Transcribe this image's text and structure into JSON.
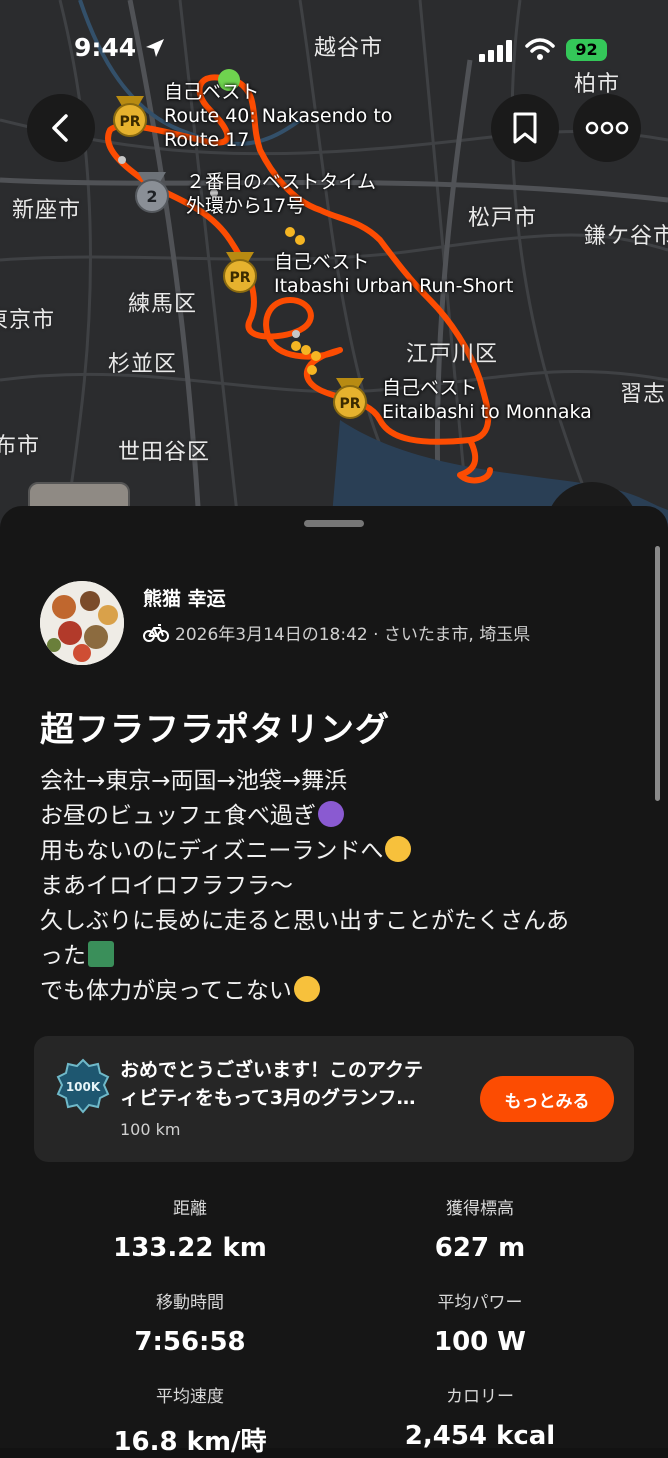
{
  "status_bar": {
    "time": "9:44",
    "battery": "92"
  },
  "map": {
    "places": [
      "越谷市",
      "柏市",
      "新座市",
      "松戸市",
      "鎌ケ谷市",
      "練馬区",
      "東京市",
      "杉並区",
      "江戸川区",
      "習志",
      "布市",
      "世田谷区"
    ],
    "segments": [
      {
        "badge": "PR",
        "lines": [
          "自己ベスト",
          "Route 40: Nakasendo to",
          "Route 17"
        ]
      },
      {
        "badge": "2",
        "lines": [
          "２番目のベストタイム",
          "外環から17号"
        ]
      },
      {
        "badge": "PR",
        "lines": [
          "自己ベスト",
          "Itabashi Urban Run-Short"
        ]
      },
      {
        "badge": "PR",
        "lines": [
          "自己ベスト",
          "Eitaibashi to Monnaka"
        ]
      }
    ],
    "colors": {
      "route": "#fc4c02",
      "pr_gold": "#e6b22e",
      "silver": "#8a8f96"
    }
  },
  "activity": {
    "athlete": "熊猫 幸运",
    "meta": "2026年3月14日の18:42 · さいたま市, 埼玉県",
    "title": "超フラフラポタリング",
    "description": [
      "会社→東京→両国→池袋→舞浜",
      "お昼のビュッフェ食べ過ぎ",
      "用もないのにディズニーランドへ",
      "まあイロイロフラフラ〜",
      "久しぶりに長めに走ると思い出すことがたくさんあ",
      "った",
      "でも体力が戻ってこない"
    ]
  },
  "promo": {
    "badge_text": "100K",
    "line1": "おめでとうございます！このアクテ",
    "line2": "ィビティをもって3月のグランフ…",
    "sub": "100 km",
    "button": "もっとみる"
  },
  "stats": [
    {
      "label": "距離",
      "value": "133.22 km"
    },
    {
      "label": "獲得標高",
      "value": "627 m"
    },
    {
      "label": "移動時間",
      "value": "7:56:58"
    },
    {
      "label": "平均パワー",
      "value": "100 W"
    },
    {
      "label": "平均速度",
      "value": "16.8 km/時"
    },
    {
      "label": "カロリー",
      "value": "2,454 kcal"
    }
  ],
  "colors": {
    "accent": "#fc4c02",
    "background": "#161616",
    "card": "#262626"
  }
}
